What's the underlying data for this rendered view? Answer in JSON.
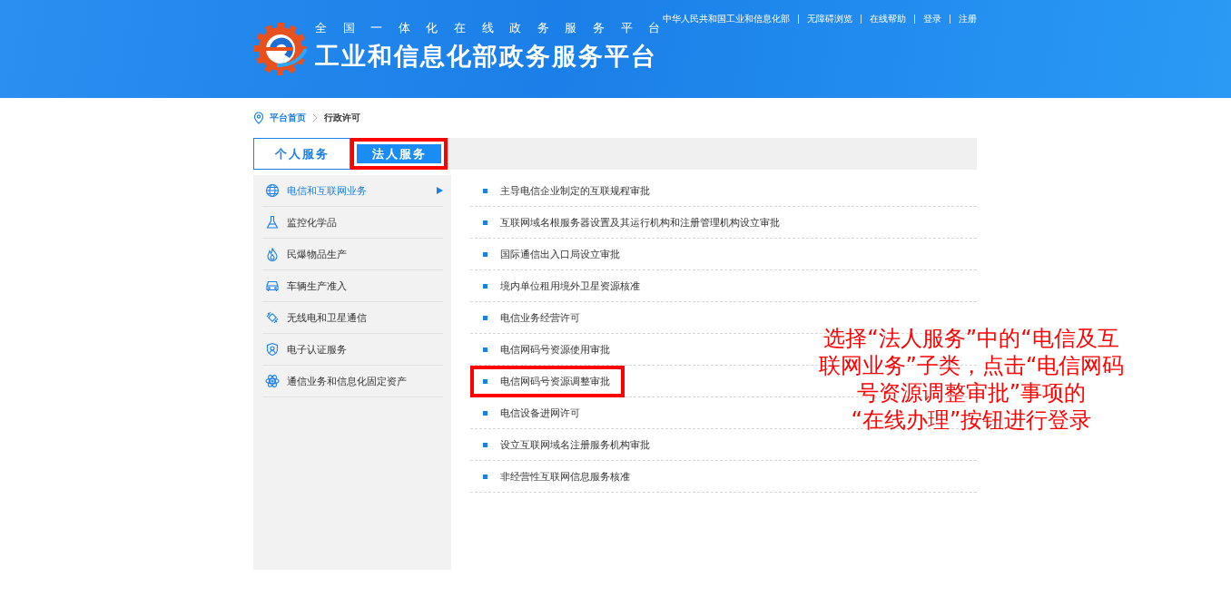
{
  "header": {
    "top_links": [
      "中华人民共和国工业和信息化部",
      "无障碍浏览",
      "在线帮助",
      "登录",
      "注册"
    ],
    "subtitle": "全国一体化在线政务服务平台",
    "title": "工业和信息化部政务服务平台"
  },
  "breadcrumb": {
    "home": "平台首页",
    "current": "行政许可"
  },
  "tabs": [
    {
      "label": "个人服务",
      "selected": false,
      "highlighted": false
    },
    {
      "label": "法人服务",
      "selected": true,
      "highlighted": true
    }
  ],
  "sidebar": {
    "items": [
      {
        "label": "电信和互联网业务",
        "selected": true
      },
      {
        "label": "监控化学品",
        "selected": false
      },
      {
        "label": "民爆物品生产",
        "selected": false
      },
      {
        "label": "车辆生产准入",
        "selected": false
      },
      {
        "label": "无线电和卫星通信",
        "selected": false
      },
      {
        "label": "电子认证服务",
        "selected": false
      },
      {
        "label": "通信业务和信息化固定资产",
        "selected": false
      }
    ]
  },
  "items": [
    {
      "label": "主导电信企业制定的互联规程审批",
      "highlighted": false
    },
    {
      "label": "互联网域名根服务器设置及其运行机构和注册管理机构设立审批",
      "highlighted": false
    },
    {
      "label": "国际通信出入口局设立审批",
      "highlighted": false
    },
    {
      "label": "境内单位租用境外卫星资源核准",
      "highlighted": false
    },
    {
      "label": "电信业务经营许可",
      "highlighted": false
    },
    {
      "label": "电信网码号资源使用审批",
      "highlighted": false
    },
    {
      "label": "电信网码号资源调整审批",
      "highlighted": true
    },
    {
      "label": "电信设备进网许可",
      "highlighted": false
    },
    {
      "label": "设立互联网域名注册服务机构审批",
      "highlighted": false
    },
    {
      "label": "非经营性互联网信息服务核准",
      "highlighted": false
    }
  ],
  "annotation": {
    "lines": [
      "选择“法人服务”中的“电信及互",
      "联网业务”子类，点击“电信网码",
      "号资源调整审批”事项的",
      "“在线办理”按钮进行登录"
    ]
  }
}
